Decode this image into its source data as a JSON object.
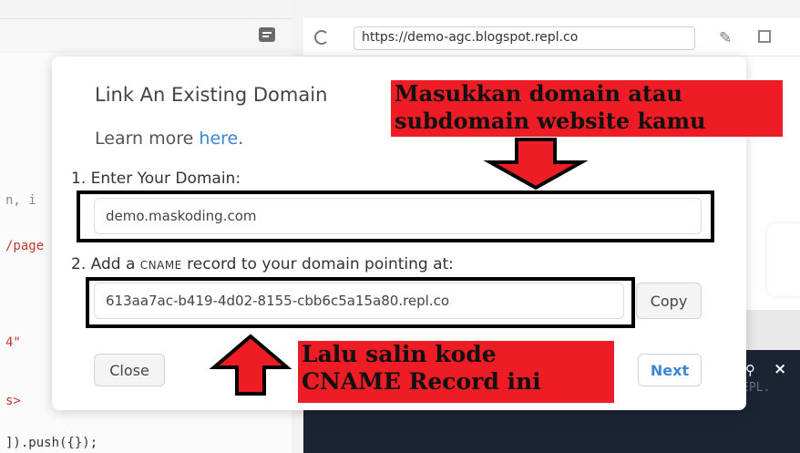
{
  "browser": {
    "url": "https://demo-agc.blogspot.repl.co"
  },
  "editor": {
    "lines": [
      {
        "text": "n, i"
      },
      {
        "text": "/page"
      },
      {
        "text": "4\""
      },
      {
        "text": "s>"
      },
      {
        "text": "]).push({});"
      }
    ]
  },
  "console": {
    "text": "EPL."
  },
  "modal": {
    "title": "Link An Existing Domain",
    "learn_prefix": "Learn more ",
    "learn_link": "here",
    "learn_suffix": ".",
    "step1_label": "1. Enter Your Domain:",
    "domain_value": "demo.maskoding.com",
    "step2_prefix": "2. Add a ",
    "step2_cname": "CNAME",
    "step2_suffix": " record to your domain pointing at:",
    "cname_value": "613aa7ac-b419-4d02-8155-cbb6c5a15a80.repl.co",
    "copy_label": "Copy",
    "close_label": "Close",
    "next_label": "Next"
  },
  "annotations": {
    "callout1_line1": "Masukkan domain atau",
    "callout1_line2": "subdomain website kamu",
    "callout2_line1": "Lalu salin kode",
    "callout2_line2": "CNAME Record ini",
    "callout_color": "#ee1c24"
  }
}
